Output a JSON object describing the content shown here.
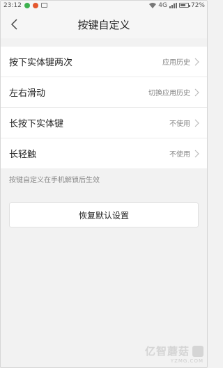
{
  "status_bar": {
    "time": "23:12",
    "network": "4G",
    "battery": "72%",
    "battery_level": 0.72,
    "icons": [
      "wechat-icon",
      "weibo-icon",
      "message-icon",
      "wifi-icon",
      "signal-icon",
      "battery-icon"
    ]
  },
  "header": {
    "title": "按键自定义",
    "back_icon": "chevron-left-icon"
  },
  "settings": [
    {
      "label": "按下实体键两次",
      "value": "应用历史"
    },
    {
      "label": "左右滑动",
      "value": "切换应用历史"
    },
    {
      "label": "长按下实体键",
      "value": "不使用"
    },
    {
      "label": "长轻触",
      "value": "不使用"
    }
  ],
  "hint": "按键自定义在手机解锁后生效",
  "reset_button": "恢复默认设置",
  "watermark": {
    "brand": "亿智蘑菇",
    "url": "YZMG.COM"
  },
  "colors": {
    "background": "#f2f2f2",
    "surface": "#ffffff",
    "text_primary": "#222222",
    "text_secondary": "#888888"
  }
}
